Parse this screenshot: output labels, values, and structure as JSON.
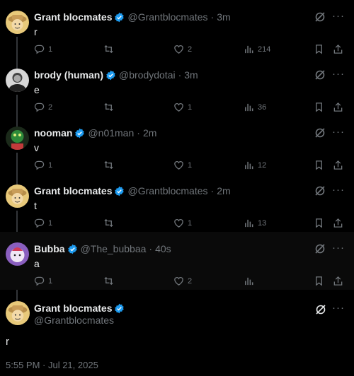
{
  "tweets": [
    {
      "name": "Grant blocmates",
      "handle": "@Grantblocmates",
      "time": "3m",
      "text": "r",
      "replies": "1",
      "likes": "2",
      "views": "214",
      "avatar": "hat"
    },
    {
      "name": "brody (human)",
      "handle": "@brodydotai",
      "time": "3m",
      "text": "e",
      "replies": "2",
      "likes": "1",
      "views": "36",
      "avatar": "bw"
    },
    {
      "name": "nooman",
      "handle": "@n01man",
      "time": "2m",
      "text": "v",
      "replies": "1",
      "likes": "1",
      "views": "12",
      "avatar": "green"
    },
    {
      "name": "Grant blocmates",
      "handle": "@Grantblocmates",
      "time": "2m",
      "text": "t",
      "replies": "1",
      "likes": "1",
      "views": "13",
      "avatar": "hat"
    },
    {
      "name": "Bubba",
      "handle": "@The_bubbaa",
      "time": "40s",
      "text": "a",
      "replies": "1",
      "likes": "2",
      "views": "",
      "avatar": "bubba"
    }
  ],
  "sep": "·",
  "main_tweet": {
    "name": "Grant blocmates",
    "handle": "@Grantblocmates",
    "text": "r",
    "timestamp": "5:55 PM · Jul 21, 2025"
  },
  "colors": {
    "verified": "#1d9bf0",
    "muted": "#71767b",
    "thread_line": "#333639"
  }
}
